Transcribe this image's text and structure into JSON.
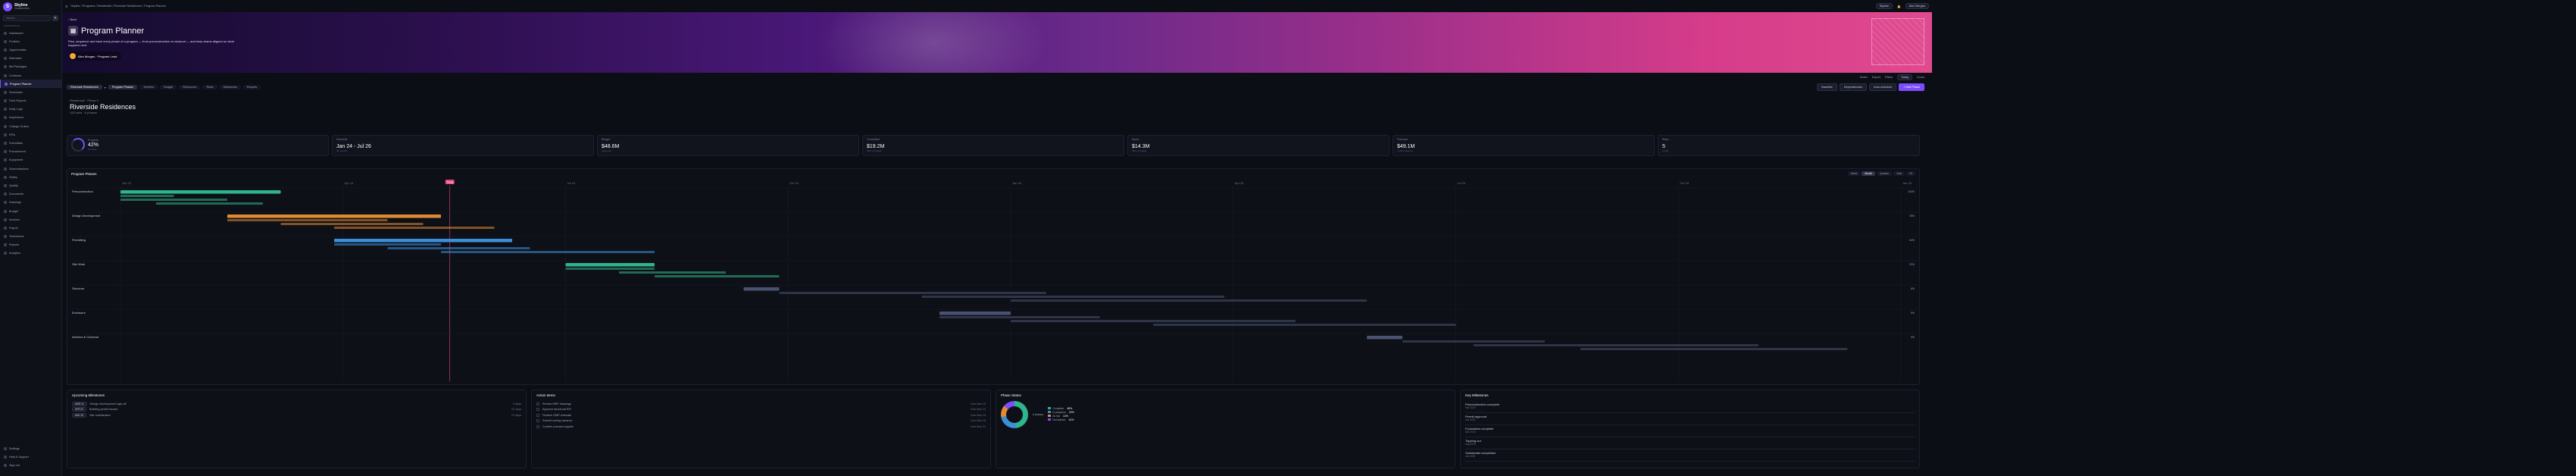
{
  "sidebar": {
    "brand_name": "Skyline",
    "brand_sub": "Construction",
    "search_placeholder": "Search...",
    "section_label": "Workspace",
    "items": [
      {
        "label": "Dashboard"
      },
      {
        "label": "Portfolio"
      },
      {
        "label": "Opportunities"
      },
      {
        "label": "Estimates"
      },
      {
        "label": "Bid Packages"
      },
      {
        "label": "Contracts"
      },
      {
        "label": "Program Planner",
        "active": true
      },
      {
        "label": "Schedules"
      },
      {
        "label": "Field Reports"
      },
      {
        "label": "Daily Logs"
      },
      {
        "label": "Inspections"
      },
      {
        "label": "Change Orders"
      },
      {
        "label": "RFIs"
      },
      {
        "label": "Submittals"
      },
      {
        "label": "Procurement"
      },
      {
        "label": "Equipment"
      },
      {
        "label": "Subcontractors"
      },
      {
        "label": "Safety"
      },
      {
        "label": "Quality"
      },
      {
        "label": "Documents"
      },
      {
        "label": "Drawings"
      },
      {
        "label": "Budget"
      },
      {
        "label": "Invoices"
      },
      {
        "label": "Payroll"
      },
      {
        "label": "Timesheets"
      },
      {
        "label": "Reports"
      },
      {
        "label": "Analytics"
      }
    ],
    "bottom": [
      {
        "label": "Settings"
      },
      {
        "label": "Help & Support"
      },
      {
        "label": "Sign out"
      }
    ]
  },
  "topbar": {
    "path": "Skyline / Programs / Residential / Riverside Residences / Program Planner",
    "user": "Alex Morgan",
    "workspace": "Skyline"
  },
  "hero": {
    "crumb": "‹ Back",
    "title": "Program Planner",
    "description": "Plan, sequence and track every phase of a program — from preconstruction to closeout — and keep teams aligned on what happens next.",
    "owner": "Alex Morgan · Program Lead"
  },
  "toolbar": {
    "items": [
      "Share",
      "Export",
      "Filters",
      "Today",
      "Zoom"
    ]
  },
  "tabs": {
    "project_select": "Riverside Residences",
    "items": [
      {
        "label": "Program Phases",
        "active": true
      },
      {
        "label": "Timeline"
      },
      {
        "label": "Budget"
      },
      {
        "label": "Resources"
      },
      {
        "label": "Risks"
      },
      {
        "label": "Milestones"
      },
      {
        "label": "Reports"
      }
    ],
    "btn_baseline": "Baseline",
    "btn_dependencies": "Dependencies",
    "btn_auto_schedule": "Auto-schedule",
    "btn_add_phase": "+ Add Phase"
  },
  "project": {
    "sub": "Residential · Phase 2",
    "name": "Riverside Residences",
    "meta": "128 units · 6 phases"
  },
  "kpis": [
    {
      "label": "Progress",
      "value": "42%",
      "sub": "On track"
    },
    {
      "label": "Schedule",
      "value": "Jan 24 - Jul 26",
      "sub": "30 months"
    },
    {
      "label": "Budget",
      "value": "$48.6M",
      "sub": "Approved"
    },
    {
      "label": "Committed",
      "value": "$19.2M",
      "sub": "39% of budget"
    },
    {
      "label": "Spent",
      "value": "$14.3M",
      "sub": "29% of budget"
    },
    {
      "label": "Forecast",
      "value": "$49.1M",
      "sub": "+1.0% variance"
    },
    {
      "label": "Risks",
      "value": "5",
      "sub": "2 high"
    }
  ],
  "timeline": {
    "title": "Program Phases",
    "views": [
      {
        "label": "Week"
      },
      {
        "label": "Month",
        "on": true
      },
      {
        "label": "Quarter"
      },
      {
        "label": "Year"
      },
      {
        "label": "Fit"
      }
    ],
    "months": [
      "Jan 24",
      "Apr 24",
      "Jul 24",
      "Oct 24",
      "Jan 25",
      "Apr 25",
      "Jul 25",
      "Oct 25",
      "Jan 26"
    ],
    "today_label": "Today",
    "phases": [
      {
        "name": "Preconstruction",
        "pct": "100%",
        "color": "#2fb58b",
        "start": 0.0,
        "end": 0.09,
        "tasks": [
          [
            0.0,
            0.03
          ],
          [
            0.0,
            0.06
          ],
          [
            0.02,
            0.08
          ]
        ]
      },
      {
        "name": "Design Development",
        "pct": "78%",
        "color": "#e08a32",
        "start": 0.06,
        "end": 0.18,
        "tasks": [
          [
            0.06,
            0.15
          ],
          [
            0.09,
            0.17
          ],
          [
            0.12,
            0.21
          ]
        ]
      },
      {
        "name": "Permitting",
        "pct": "64%",
        "color": "#3a8fd8",
        "start": 0.12,
        "end": 0.22,
        "tasks": [
          [
            0.12,
            0.18
          ],
          [
            0.15,
            0.23
          ],
          [
            0.18,
            0.3
          ]
        ]
      },
      {
        "name": "Site Work",
        "pct": "22%",
        "color": "#2fb58b",
        "start": 0.25,
        "end": 0.3,
        "tasks": [
          [
            0.25,
            0.3
          ],
          [
            0.28,
            0.34
          ],
          [
            0.3,
            0.37
          ]
        ]
      },
      {
        "name": "Structure",
        "pct": "6%",
        "color": "#4a5270",
        "start": 0.35,
        "end": 0.37,
        "tasks": [
          [
            0.37,
            0.52
          ],
          [
            0.45,
            0.62
          ],
          [
            0.5,
            0.7
          ]
        ]
      },
      {
        "name": "Enclosure",
        "pct": "0%",
        "color": "#4a5270",
        "start": 0.46,
        "end": 0.5,
        "tasks": [
          [
            0.46,
            0.55
          ],
          [
            0.5,
            0.66
          ],
          [
            0.58,
            0.75
          ]
        ]
      },
      {
        "name": "Interiors & Closeout",
        "pct": "0%",
        "color": "#4a5270",
        "start": 0.7,
        "end": 0.72,
        "tasks": [
          [
            0.72,
            0.8
          ],
          [
            0.76,
            0.92
          ],
          [
            0.82,
            0.97
          ]
        ]
      }
    ]
  },
  "cards": {
    "upcoming": {
      "title": "Upcoming Milestones",
      "items": [
        {
          "tag": "MAR 14",
          "text": "Design development sign-off",
          "right": "3 days"
        },
        {
          "tag": "APR 02",
          "text": "Building permit issued",
          "right": "22 days"
        },
        {
          "tag": "MAY 20",
          "text": "Site mobilization",
          "right": "70 days"
        }
      ]
    },
    "tasks": {
      "title": "Action Items",
      "items": [
        {
          "text": "Review MEP drawings",
          "right": "Due Mar 12"
        },
        {
          "text": "Approve structural RFI",
          "right": "Due Mar 13"
        },
        {
          "text": "Finalize GMP estimate",
          "right": "Due Mar 15"
        },
        {
          "text": "Submit zoning variance",
          "right": "Due Mar 18"
        },
        {
          "text": "Confirm precast supplier",
          "right": "Due Mar 21"
        }
      ]
    },
    "status": {
      "title": "Phase Status",
      "center": "6 phases",
      "legend": [
        {
          "label": "Complete",
          "color": "#2fb58b",
          "value": "48%"
        },
        {
          "label": "In progress",
          "color": "#3a8fd8",
          "value": "24%"
        },
        {
          "label": "At risk",
          "color": "#e08a32",
          "value": "14%"
        },
        {
          "label": "Not started",
          "color": "#7c4dff",
          "value": "14%"
        }
      ]
    },
    "milestones": {
      "title": "Key Milestones",
      "items": [
        {
          "t": "Preconstruction complete",
          "d": "Mar 2024"
        },
        {
          "t": "Permit approval",
          "d": "Jun 2024"
        },
        {
          "t": "Foundation complete",
          "d": "Dec 2024"
        },
        {
          "t": "Topping out",
          "d": "Aug 2025"
        },
        {
          "t": "Substantial completion",
          "d": "Jun 2026"
        }
      ]
    }
  }
}
